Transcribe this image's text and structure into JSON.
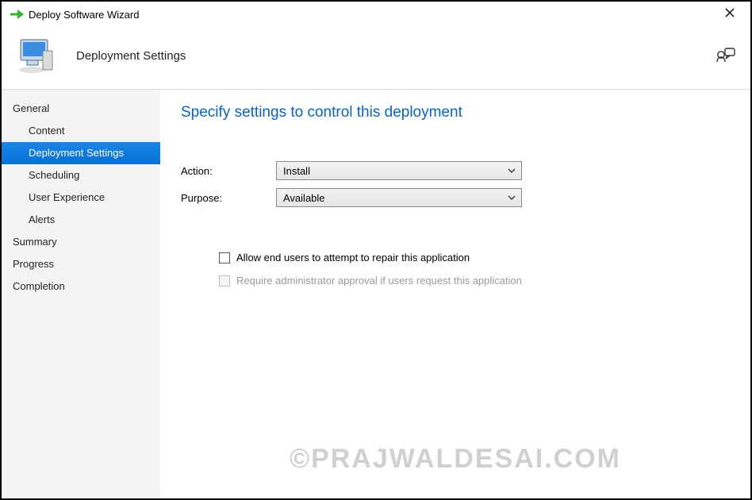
{
  "window": {
    "title": "Deploy Software Wizard"
  },
  "header": {
    "title": "Deployment Settings"
  },
  "sidebar": {
    "items": [
      {
        "label": "General",
        "indent": false,
        "active": false
      },
      {
        "label": "Content",
        "indent": true,
        "active": false
      },
      {
        "label": "Deployment Settings",
        "indent": true,
        "active": true
      },
      {
        "label": "Scheduling",
        "indent": true,
        "active": false
      },
      {
        "label": "User Experience",
        "indent": true,
        "active": false
      },
      {
        "label": "Alerts",
        "indent": true,
        "active": false
      },
      {
        "label": "Summary",
        "indent": false,
        "active": false
      },
      {
        "label": "Progress",
        "indent": false,
        "active": false
      },
      {
        "label": "Completion",
        "indent": false,
        "active": false
      }
    ]
  },
  "page": {
    "heading": "Specify settings to control this deployment",
    "action_label": "Action:",
    "action_value": "Install",
    "purpose_label": "Purpose:",
    "purpose_value": "Available",
    "allow_repair_label": "Allow end users to attempt to repair this application",
    "require_approval_label": "Require administrator approval if users request this application"
  },
  "watermark": "©PRAJWALDESAI.COM"
}
